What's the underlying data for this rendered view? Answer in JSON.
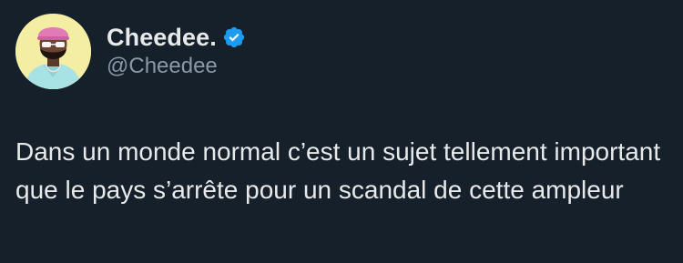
{
  "author": {
    "display_name": "Cheedee.",
    "handle": "@Cheedee",
    "verified": true,
    "avatar_icon": "avatar-illustration"
  },
  "tweet": {
    "text": "Dans un monde normal c’est un sujet tellement important que le pays s’arrête pour un scandal de cette ampleur"
  },
  "colors": {
    "background": "#15202b",
    "text_primary": "#e7e9ea",
    "text_secondary": "#8b98a5",
    "verified_blue": "#1d9bf0",
    "avatar_bg": "#f3eea4"
  }
}
